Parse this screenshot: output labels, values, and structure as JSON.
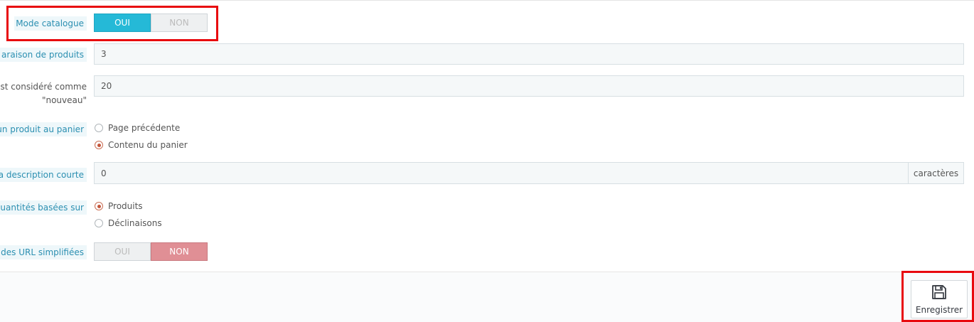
{
  "form": {
    "catalog_mode": {
      "label": "Mode catalogue",
      "yes": "OUI",
      "no": "NON",
      "selected": "yes"
    },
    "compare_products": {
      "label": "araison de produits",
      "value": "3"
    },
    "new_days": {
      "label_line1": "est considéré comme",
      "label_line2": "\"nouveau\"",
      "value": "20"
    },
    "add_to_cart": {
      "label": "un produit au panier",
      "options": [
        "Page précédente",
        "Contenu du panier"
      ],
      "selected_index": 1
    },
    "short_desc": {
      "label": "a description courte",
      "value": "0",
      "addon": "caractères"
    },
    "quantities": {
      "label": "quantités basées sur",
      "options": [
        "Produits",
        "Déclinaisons"
      ],
      "selected_index": 0
    },
    "friendly_urls": {
      "label": "des URL simplifiées",
      "yes": "OUI",
      "no": "NON",
      "selected": "no"
    }
  },
  "footer": {
    "save_label": "Enregistrer",
    "save_icon": "floppy-disk-icon"
  },
  "colors": {
    "accent_blue": "#25b9d7",
    "accent_red": "#e08f95",
    "label_blue": "#2b8fb1",
    "highlight_box": "#e8090e"
  }
}
